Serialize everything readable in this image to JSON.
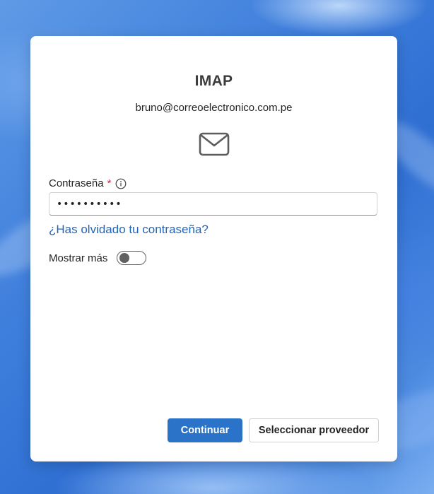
{
  "dialog": {
    "title": "IMAP",
    "email": "bruno@correoelectronico.com.pe",
    "icon": "mail-icon"
  },
  "password": {
    "label": "Contraseña",
    "required_mark": "*",
    "value": "••••••••••",
    "info_icon": "info-icon"
  },
  "forgot_link": "¿Has olvidado tu contraseña?",
  "show_more": {
    "label": "Mostrar más",
    "enabled": false
  },
  "buttons": {
    "continue": "Continuar",
    "select_provider": "Seleccionar proveedor"
  },
  "colors": {
    "primary": "#2b73c8",
    "link": "#2266b8",
    "required": "#c4314b"
  }
}
